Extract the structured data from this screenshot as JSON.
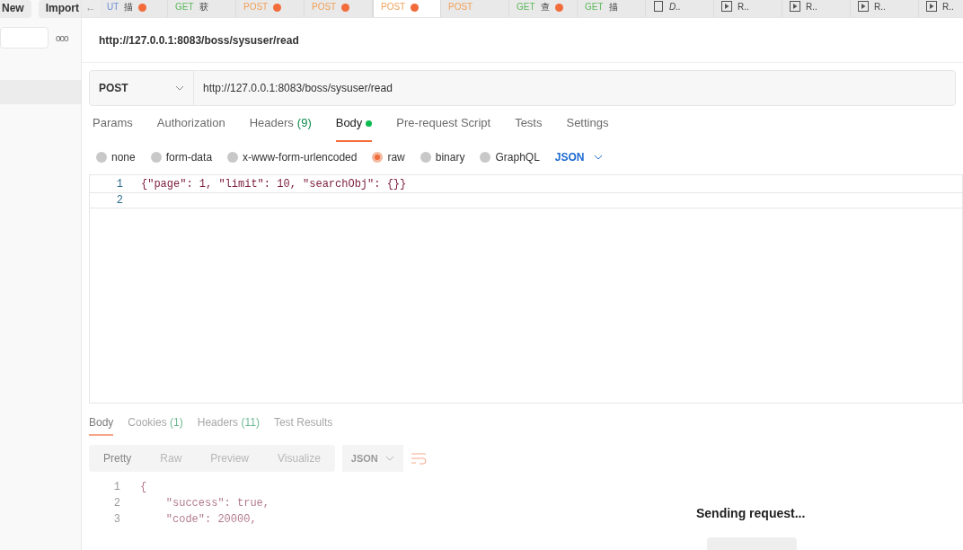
{
  "sidebar": {
    "buttons": [
      "New",
      "Import"
    ],
    "more": "ooo"
  },
  "tabs": [
    {
      "method": "UT",
      "name": "描",
      "dirty": true,
      "selected": false,
      "kind": "request"
    },
    {
      "method": "GET",
      "name": "获",
      "dirty": false,
      "selected": false,
      "kind": "request"
    },
    {
      "method": "POST",
      "dirty": true,
      "selected": false,
      "kind": "request"
    },
    {
      "method": "POST",
      "dirty": true,
      "selected": false,
      "kind": "request"
    },
    {
      "method": "POST",
      "dirty": true,
      "selected": true,
      "kind": "request"
    },
    {
      "method": "POST",
      "dirty": false,
      "selected": false,
      "kind": "request"
    },
    {
      "method": "GET",
      "name": "查",
      "dirty": true,
      "selected": false,
      "kind": "request"
    },
    {
      "method": "GET",
      "name": "描",
      "dirty": false,
      "selected": false,
      "kind": "request"
    },
    {
      "name": "D..",
      "dirty": false,
      "selected": false,
      "kind": "doc"
    },
    {
      "name": "R..",
      "dirty": false,
      "selected": false,
      "kind": "runner"
    },
    {
      "name": "R..",
      "dirty": false,
      "selected": false,
      "kind": "runner"
    },
    {
      "name": "R..",
      "dirty": false,
      "selected": false,
      "kind": "runner"
    },
    {
      "name": "R..",
      "dirty": false,
      "selected": false,
      "kind": "runner"
    }
  ],
  "back_arrow": "←",
  "request_title": "http://127.0.0.1:8083/boss/sysuser/read",
  "method": "POST",
  "url": "http://127.0.0.1:8083/boss/sysuser/read",
  "request_tabs": [
    {
      "label": "Params",
      "selected": false
    },
    {
      "label": "Authorization",
      "selected": false
    },
    {
      "label": "Headers",
      "count": "(9)",
      "selected": false
    },
    {
      "label": "Body",
      "selected": true,
      "dot": true
    },
    {
      "label": "Pre-request Script",
      "selected": false
    },
    {
      "label": "Tests",
      "selected": false
    },
    {
      "label": "Settings",
      "selected": false
    }
  ],
  "body_types": [
    {
      "label": "none",
      "selected": false
    },
    {
      "label": "form-data",
      "selected": false
    },
    {
      "label": "x-www-form-urlencoded",
      "selected": false
    },
    {
      "label": "raw",
      "selected": true
    },
    {
      "label": "binary",
      "selected": false
    },
    {
      "label": "GraphQL",
      "selected": false
    }
  ],
  "body_format": "JSON",
  "editor_lines": [
    {
      "number": "1",
      "text": "{\"page\": 1, \"limit\": 10, \"searchObj\": {}}"
    },
    {
      "number": "2"
    }
  ],
  "response": {
    "tabs": [
      {
        "label": "Body",
        "selected": true
      },
      {
        "label": "Cookies",
        "count": "(1)",
        "selected": false
      },
      {
        "label": "Headers",
        "count": "(11)",
        "selected": false
      },
      {
        "label": "Test Results",
        "selected": false
      }
    ],
    "views": [
      {
        "label": "Pretty",
        "selected": true
      },
      {
        "label": "Raw",
        "selected": false
      },
      {
        "label": "Preview",
        "selected": false
      },
      {
        "label": "Visualize",
        "selected": false
      }
    ],
    "format": "JSON",
    "lines": [
      {
        "number": "1",
        "text": "{"
      },
      {
        "number": "2",
        "text": "    \"success\": true,"
      },
      {
        "number": "3",
        "text": "    \"code\": 20000,"
      }
    ]
  },
  "status": "Sending request..."
}
